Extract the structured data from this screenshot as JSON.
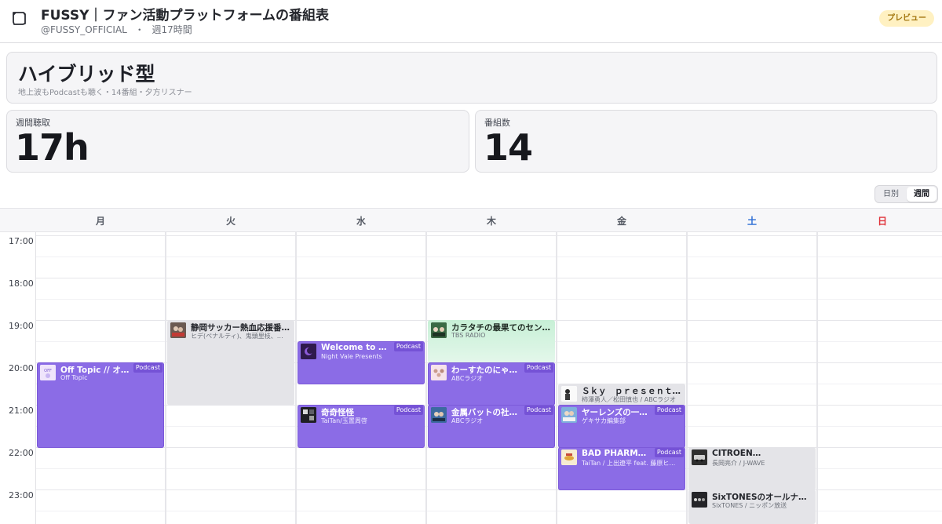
{
  "header": {
    "title": "FUSSY｜ファン活動プラットフォームの番組表",
    "account": "@FUSSY_OFFICIAL",
    "separator": "・",
    "weekly_hours": "週17時間",
    "preview_label": "プレビュー"
  },
  "profile": {
    "type_title": "ハイブリッド型",
    "type_desc": "地上波もPodcastも聴く・14番組・夕方リスナー"
  },
  "stats": {
    "weekly_label": "週間聴取",
    "weekly_value": "17h",
    "count_label": "番組数",
    "count_value": "14"
  },
  "view_toggle": {
    "day_label": "日別",
    "week_label": "週間",
    "selected": "週間"
  },
  "calendar": {
    "days": [
      "月",
      "火",
      "水",
      "木",
      "金",
      "土",
      "日"
    ],
    "times": [
      "17:00",
      "18:00",
      "19:00",
      "20:00",
      "21:00",
      "22:00",
      "23:00"
    ],
    "colors": {
      "saturday": "#2f6fd6",
      "sunday": "#e0323a",
      "podcast": "#8b6ce6",
      "broadcast": "#e4e4e8",
      "highlight": "#c7f0d6"
    },
    "events": [
      {
        "title": "Off Topic // オフトピ",
        "sub": "Off Topic",
        "badge": "Podcast"
      },
      {
        "title": "静岡サッカー熱血応援番…",
        "sub": "ヒデ(ペナルティ)、鬼頭里枝、…",
        "badge": ""
      },
      {
        "title": "Welcome to Night Vale",
        "sub": "Night Vale Presents",
        "badge": "Podcast"
      },
      {
        "title": "奇奇怪怪",
        "sub": "TaiTan/玉置周啓",
        "badge": "Podcast"
      },
      {
        "title": "カラタチの最果てのセン…",
        "sub": "TBS RADIO",
        "badge": ""
      },
      {
        "title": "わーすたのにゃんだ",
        "sub": "ABCラジオ",
        "badge": "Podcast"
      },
      {
        "title": "金属バットの社会の",
        "sub": "ABCラジオ",
        "badge": "Podcast"
      },
      {
        "title": "Ｓｋｙ　ｐｒｅｓｅｎｔ…",
        "sub": "柿澤勇人／松田慎也 / ABCラジオ",
        "badge": ""
      },
      {
        "title": "ヤーレンズの一生ボ",
        "sub": "ゲキサカ編集部",
        "badge": "Podcast"
      },
      {
        "title": "BAD PHARMACY",
        "sub": "TaiTan / 上出遼平 feat. 藤原ヒ…",
        "badge": "Podcast"
      },
      {
        "title": "CITROËN…",
        "sub": "長岡亮介 / J-WAVE",
        "badge": ""
      },
      {
        "title": "SixTONESのオールナイ…",
        "sub": "SixTONES / ニッポン放送",
        "badge": ""
      }
    ]
  }
}
